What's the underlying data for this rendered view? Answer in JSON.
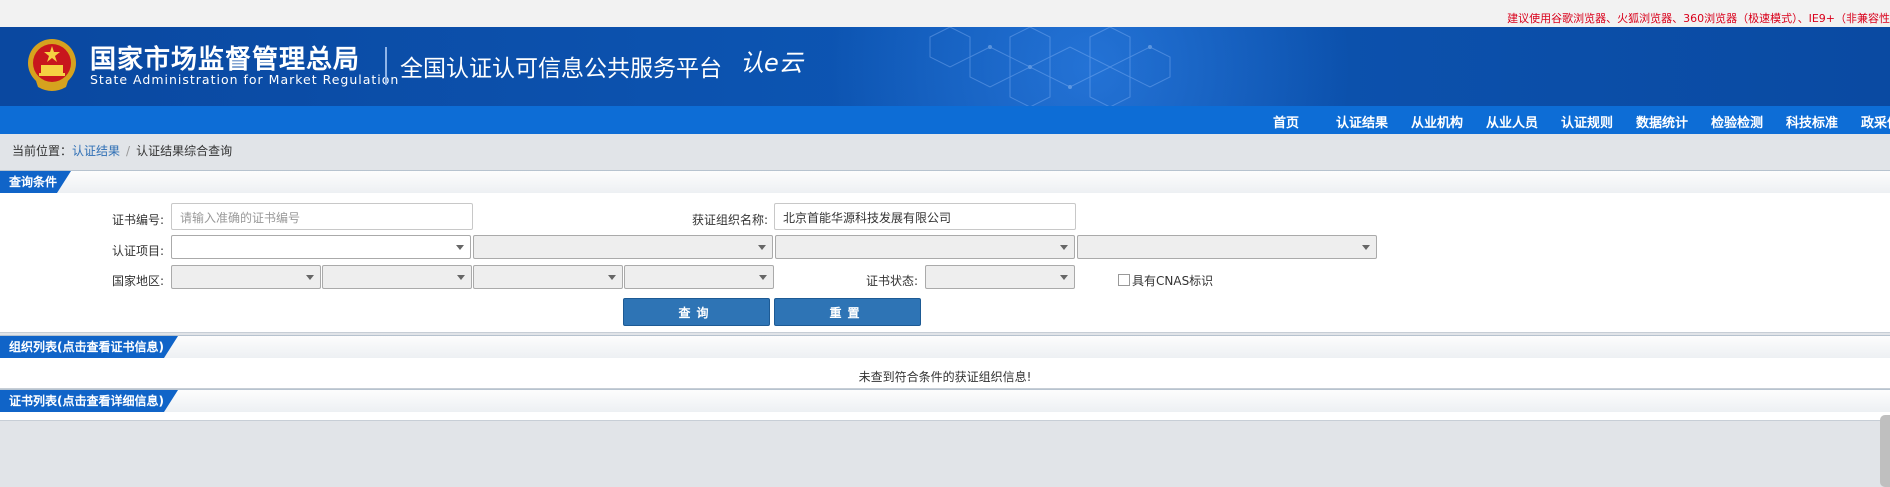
{
  "browser_tip": "建议使用谷歌浏览器、火狐浏览器、360浏览器（极速模式）、IE9+（非兼容性",
  "header": {
    "org_name_cn": "国家市场监督管理总局",
    "org_name_en": "State Administration  for  Market Regulation",
    "platform_title": "全国认证认可信息公共服务平台",
    "platform_logo": "认e云"
  },
  "nav": {
    "items": [
      "首页",
      "认证结果",
      "从业机构",
      "从业人员",
      "认证规则",
      "数据统计",
      "检验检测",
      "科技标准",
      "政采信"
    ]
  },
  "breadcrumb": {
    "prefix": "当前位置：",
    "level1": "认证结果",
    "separator": "/",
    "level2": "认证结果综合查询"
  },
  "query": {
    "section_title": "查询条件",
    "cert_no_label": "证书编号:",
    "cert_no_placeholder": "请输入准确的证书编号",
    "org_name_label": "获证组织名称:",
    "org_name_value": "北京首能华源科技发展有限公司",
    "cert_project_label": "认证项目:",
    "region_label": "国家地区:",
    "cert_status_label": "证书状态:",
    "cnas_label": "具有CNAS标识",
    "search_button": "查询",
    "reset_button": "重置"
  },
  "org_list": {
    "section_title": "组织列表(点击查看证书信息)",
    "empty_message": "未查到符合条件的获证组织信息!"
  },
  "cert_list": {
    "section_title": "证书列表(点击查看详细信息)"
  },
  "colors": {
    "header_blue": "#0d56b4",
    "nav_blue": "#0d6dd6",
    "section_tab": "#1064c8",
    "button": "#2e74b5",
    "tip_red": "#d9001b"
  }
}
